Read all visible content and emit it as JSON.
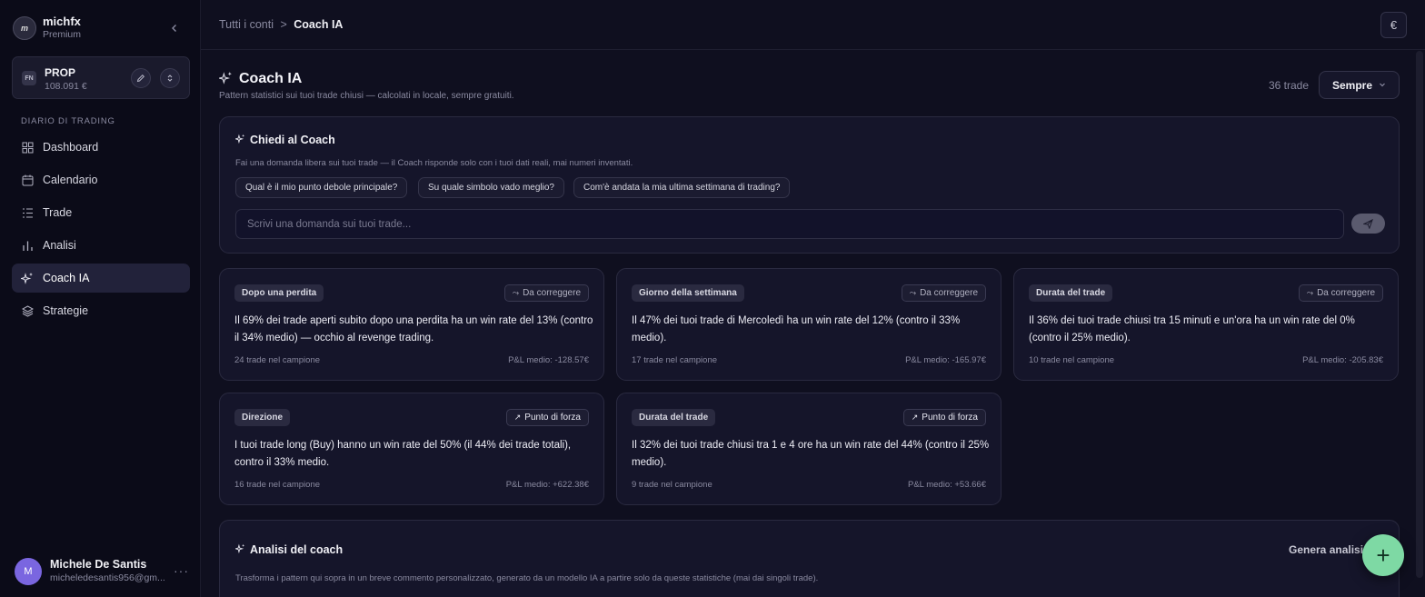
{
  "brand": {
    "name": "michfx",
    "plan": "Premium",
    "logo_text": "m"
  },
  "account": {
    "badge": "FN",
    "name": "PROP",
    "balance": "108.091 €"
  },
  "sidebar": {
    "section_label": "DIARIO DI TRADING",
    "items": [
      {
        "label": "Dashboard",
        "icon": "grid-icon"
      },
      {
        "label": "Calendario",
        "icon": "calendar-icon"
      },
      {
        "label": "Trade",
        "icon": "list-icon"
      },
      {
        "label": "Analisi",
        "icon": "bar-chart-icon"
      },
      {
        "label": "Coach IA",
        "icon": "sparkles-icon",
        "active": true
      },
      {
        "label": "Strategie",
        "icon": "layers-icon"
      }
    ]
  },
  "user": {
    "initial": "M",
    "name": "Michele De Santis",
    "email": "micheledesantis956@gm..."
  },
  "topbar": {
    "breadcrumb_root": "Tutti i conti",
    "separator": ">",
    "breadcrumb_current": "Coach IA",
    "currency": "€"
  },
  "header": {
    "title": "Coach IA",
    "subtitle": "Pattern statistici sui tuoi trade chiusi — calcolati in locale, sempre gratuiti.",
    "trade_count": "36 trade",
    "period": "Sempre"
  },
  "ask": {
    "title": "Chiedi al Coach",
    "description": "Fai una domanda libera sui tuoi trade — il Coach risponde solo con i tuoi dati reali, mai numeri inventati.",
    "suggestions": [
      "Qual è il mio punto debole principale?",
      "Su quale simbolo vado meglio?",
      "Com'è andata la mia ultima settimana di trading?"
    ],
    "placeholder": "Scrivi una domanda sui tuoi trade..."
  },
  "insights": [
    {
      "tag": "Dopo una perdita",
      "status": "Da correggere",
      "text": "Il 69% dei trade aperti subito dopo una perdita ha un win rate del 13% (contro il 34% medio) — occhio al revenge trading.",
      "sample": "24 trade nel campione",
      "pnl": "P&L medio: -128.57€"
    },
    {
      "tag": "Giorno della settimana",
      "status": "Da correggere",
      "text": "Il 47% dei tuoi trade di Mercoledì ha un win rate del 12% (contro il 33% medio).",
      "sample": "17 trade nel campione",
      "pnl": "P&L medio: -165.97€"
    },
    {
      "tag": "Durata del trade",
      "status": "Da correggere",
      "text": "Il 36% dei tuoi trade chiusi tra 15 minuti e un'ora ha un win rate del 0% (contro il 25% medio).",
      "sample": "10 trade nel campione",
      "pnl": "P&L medio: -205.83€"
    },
    {
      "tag": "Direzione",
      "status": "Punto di forza",
      "text": "I tuoi trade long (Buy) hanno un win rate del 50% (il 44% dei trade totali), contro il 33% medio.",
      "sample": "16 trade nel campione",
      "pnl": "P&L medio: +622.38€"
    },
    {
      "tag": "Durata del trade",
      "status": "Punto di forza",
      "text": "Il 32% dei tuoi trade chiusi tra 1 e 4 ore ha un win rate del 44% (contro il 25% medio).",
      "sample": "9 trade nel campione",
      "pnl": "P&L medio: +53.66€"
    }
  ],
  "analysis": {
    "title": "Analisi del coach",
    "button": "Genera analisi",
    "description": "Trasforma i pattern qui sopra in un breve commento personalizzato, generato da un modello IA a partire solo da queste statistiche (mai dai singoli trade)."
  },
  "fab": {
    "label": "+"
  },
  "colors": {
    "background": "#0f0f1f",
    "accent": "#7ed9a4",
    "avatar": "#7a66e0"
  }
}
